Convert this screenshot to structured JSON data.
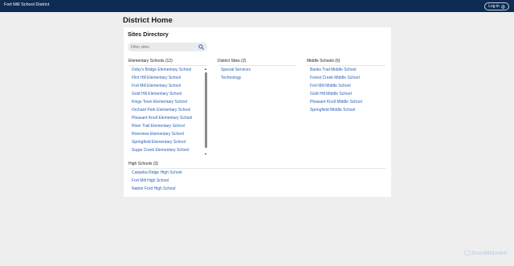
{
  "header": {
    "brand": "Fort Mill School District",
    "login_label": "Log in"
  },
  "page_title": "District Home",
  "card": {
    "title": "Sites Directory",
    "filter_placeholder": "Filter sites"
  },
  "columns": {
    "elementary": {
      "heading": "Elementary Schools (12)",
      "items": [
        "Doby's Bridge Elementary School",
        "Flint Hill Elementary School",
        "Fort Mill Elementary School",
        "Gold Hill Elementary School",
        "Kings Town Elementary School",
        "Orchard Park Elementary School",
        "Pleasant Knoll Elementary School",
        "River Trail Elementary School",
        "Riverview Elementary School",
        "Springfield Elementary School",
        "Sugar Creek Elementary School"
      ]
    },
    "district": {
      "heading": "District Sites (2)",
      "items": [
        "Special Services",
        "Technology"
      ]
    },
    "middle": {
      "heading": "Middle Schools (6)",
      "items": [
        "Banks Trail Middle School",
        "Forest Creek Middle School",
        "Fort Mill Middle School",
        "Gold Hill Middle School",
        "Pleasant Knoll Middle School",
        "Springfield Middle School"
      ]
    },
    "high": {
      "heading": "High Schools (3)",
      "items": [
        "Catawba Ridge High School",
        "Fort Mill High School",
        "Nation Ford High School"
      ]
    }
  },
  "watermark": "ScanMalware"
}
